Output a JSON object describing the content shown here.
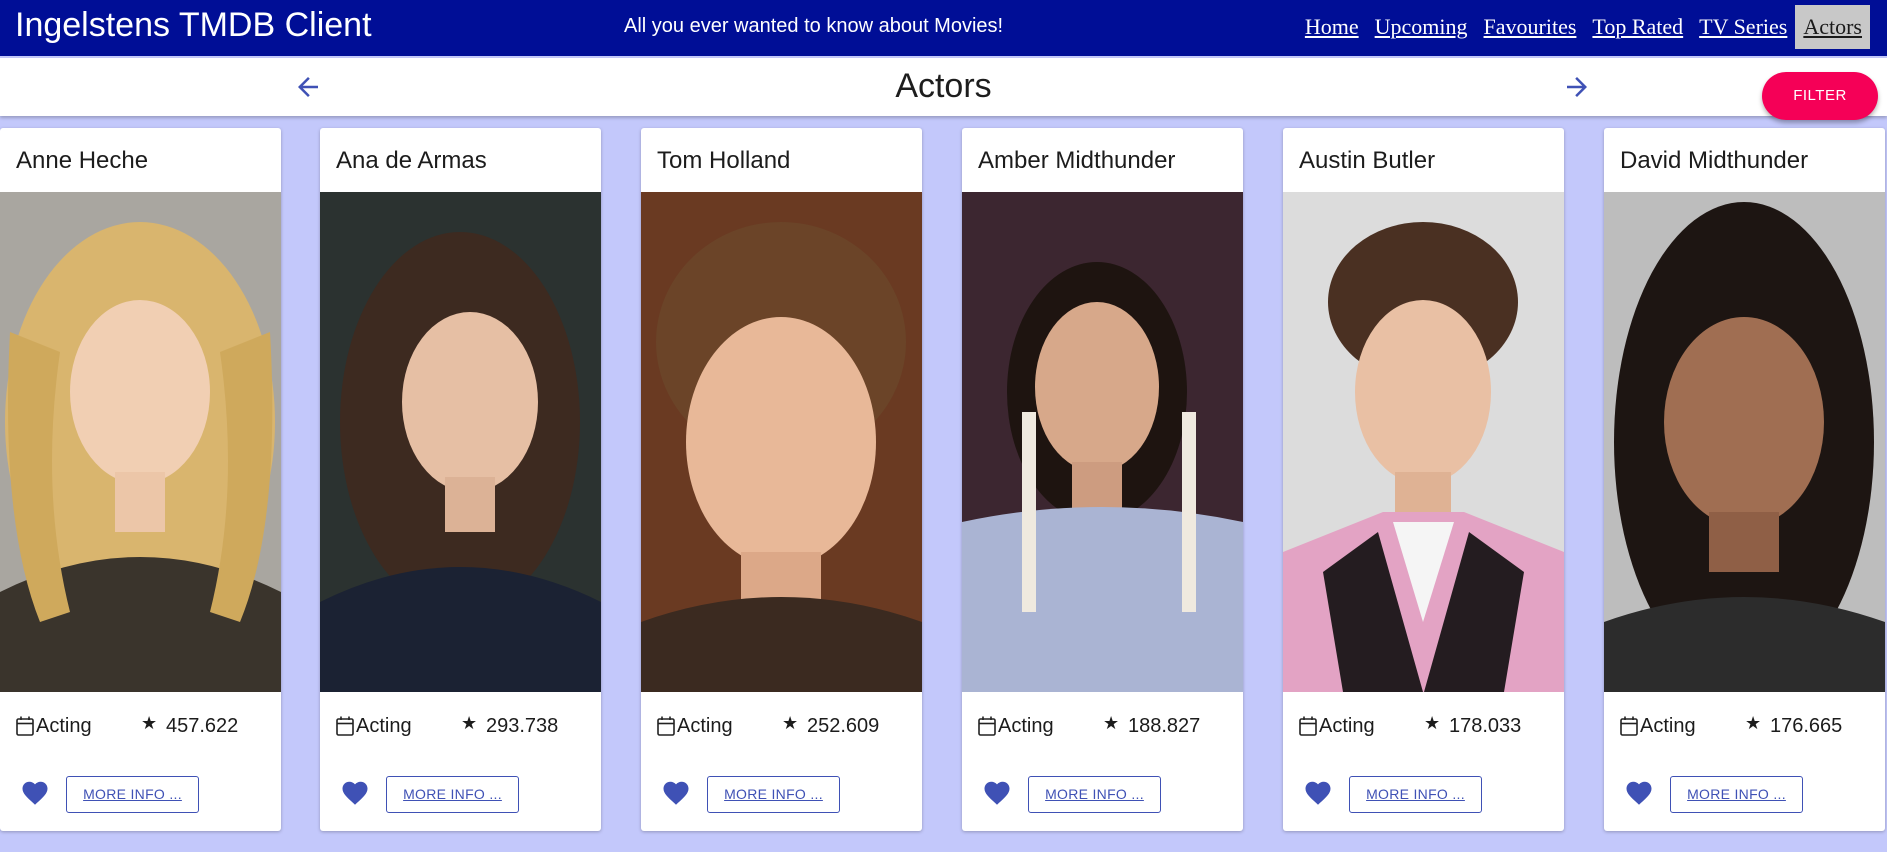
{
  "app": {
    "title": "Ingelstens TMDB Client",
    "tagline": "All you ever wanted to know about Movies!"
  },
  "nav": {
    "items": [
      {
        "label": "Home",
        "active": false
      },
      {
        "label": "Upcoming",
        "active": false
      },
      {
        "label": "Favourites",
        "active": false
      },
      {
        "label": "Top Rated",
        "active": false
      },
      {
        "label": "TV Series",
        "active": false
      },
      {
        "label": "Actors",
        "active": true
      }
    ]
  },
  "page": {
    "title": "Actors",
    "filter_label": "FILTER"
  },
  "colors": {
    "header_bg": "#000e96",
    "page_bg": "#c3c8fb",
    "accent": "#3f51b5",
    "filter_bg": "#f50057"
  },
  "actors": [
    {
      "name": "Anne Heche",
      "department": "Acting",
      "popularity": "457.622",
      "more_label": "MORE INFO ..."
    },
    {
      "name": "Ana de Armas",
      "department": "Acting",
      "popularity": "293.738",
      "more_label": "MORE INFO ..."
    },
    {
      "name": "Tom Holland",
      "department": "Acting",
      "popularity": "252.609",
      "more_label": "MORE INFO ..."
    },
    {
      "name": "Amber Midthunder",
      "department": "Acting",
      "popularity": "188.827",
      "more_label": "MORE INFO ..."
    },
    {
      "name": "Austin Butler",
      "department": "Acting",
      "popularity": "178.033",
      "more_label": "MORE INFO ..."
    },
    {
      "name": "David Midthunder",
      "department": "Acting",
      "popularity": "176.665",
      "more_label": "MORE INFO ..."
    }
  ]
}
